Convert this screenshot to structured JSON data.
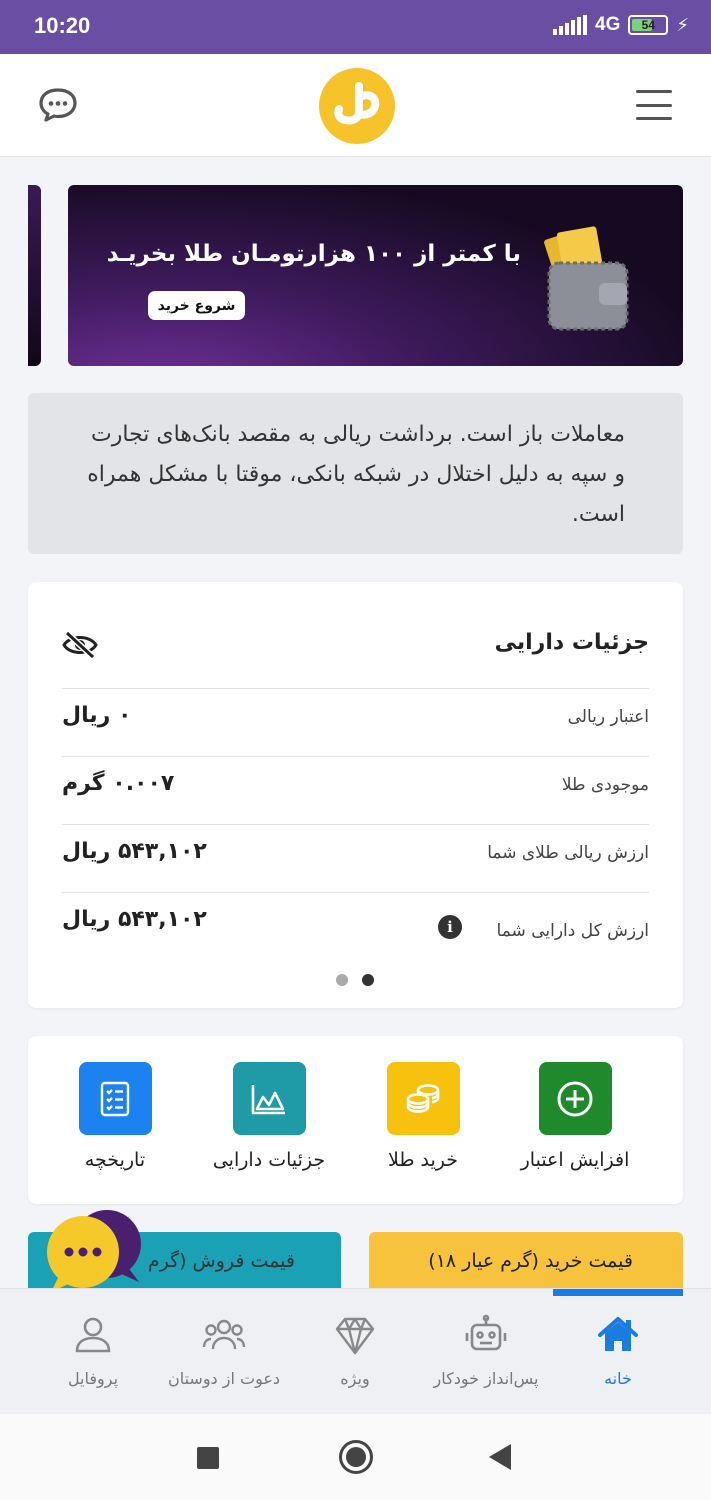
{
  "status_bar": {
    "time": "10:20",
    "network": "4G",
    "battery": "54"
  },
  "header": {
    "logo_icon": "taaghche-gold-logo",
    "chat_icon": "chat-bubble-icon",
    "menu_icon": "hamburger-menu-icon"
  },
  "banner": {
    "title": "با کمتر از ۱۰۰ هزارتومـان طلا بخریـد",
    "button": "شروع خرید"
  },
  "notice": {
    "text": "معاملات باز است. برداشت ریالی به مقصد بانک‌های تجارت و سپه به دلیل اختلال در شبکه بانکی، موقتا با مشکل همراه است."
  },
  "asset_details": {
    "title": "جزئیات دارایی",
    "rows": [
      {
        "label": "اعتبار ریالی",
        "value": "۰ ریال"
      },
      {
        "label": "موجودی طلا",
        "value": "۰.۰۰۷ گرم"
      },
      {
        "label": "ارزش ریالی طلای شما",
        "value": "۵۴۳,۱۰۲ ریال"
      },
      {
        "label": "ارزش کل دارایی شما",
        "value": "۵۴۳,۱۰۲ ریال"
      }
    ],
    "info_glyph": "i",
    "pager": {
      "count": 2,
      "active": 1
    }
  },
  "quick_actions": [
    {
      "label": "افزایش اعتبار",
      "icon": "plus-circle-icon",
      "color": "#1f8a2c"
    },
    {
      "label": "خرید طلا",
      "icon": "coins-icon",
      "color": "#f7c20e"
    },
    {
      "label": "جزئیات دارایی",
      "icon": "chart-icon",
      "color": "#1f9aa7"
    },
    {
      "label": "تاریخچه",
      "icon": "checklist-icon",
      "color": "#1b82f0"
    }
  ],
  "price_tabs": {
    "buy": "قیمت خرید (گرم عیار ۱۸)",
    "sell": "قیمت فروش (گرم"
  },
  "bottom_nav": {
    "active": "home",
    "items": [
      {
        "id": "home",
        "label": "خانه",
        "icon": "home-icon"
      },
      {
        "id": "auto-save",
        "label": "پس‌انداز خودکار",
        "icon": "robot-icon"
      },
      {
        "id": "special",
        "label": "ویژه",
        "icon": "diamond-icon"
      },
      {
        "id": "invite",
        "label": "دعوت از دوستان",
        "icon": "users-icon"
      },
      {
        "id": "profile",
        "label": "پروفایل",
        "icon": "user-icon"
      }
    ]
  },
  "colors": {
    "status_bar": "#6a4ea3",
    "accent_blue": "#1a7be0",
    "gold": "#f6c32b"
  }
}
